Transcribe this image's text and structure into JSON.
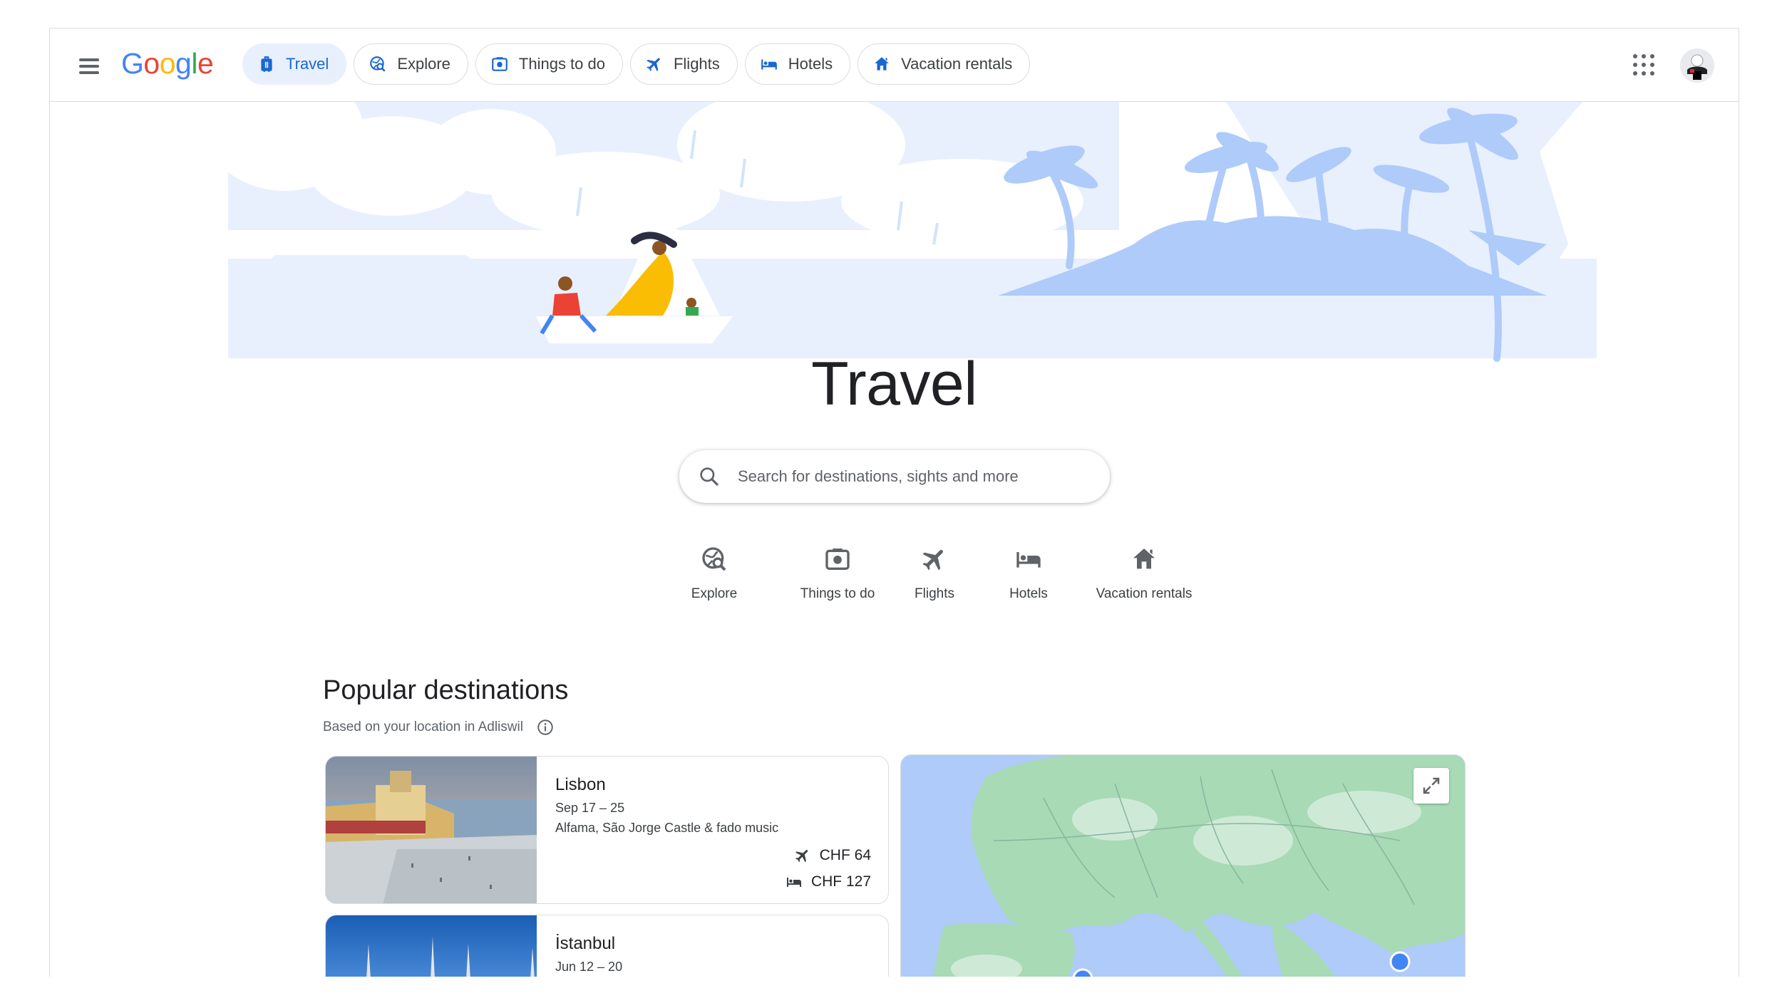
{
  "header": {
    "logo_text": "Google",
    "logo_colors": [
      "#4285F4",
      "#EA4335",
      "#FBBC05",
      "#4285F4",
      "#34A853",
      "#EA4335"
    ],
    "tabs": [
      {
        "label": "Travel",
        "icon": "luggage-icon",
        "active": true
      },
      {
        "label": "Explore",
        "icon": "explore-globe-icon",
        "active": false
      },
      {
        "label": "Things to do",
        "icon": "camera-icon",
        "active": false
      },
      {
        "label": "Flights",
        "icon": "airplane-icon",
        "active": false
      },
      {
        "label": "Hotels",
        "icon": "bed-icon",
        "active": false
      },
      {
        "label": "Vacation rentals",
        "icon": "house-icon",
        "active": false
      }
    ],
    "accent_color": "#1967D2"
  },
  "hero": {
    "title": "Travel",
    "search_placeholder": "Search for destinations, sights and more"
  },
  "quick_links": [
    {
      "label": "Explore",
      "icon": "explore-globe-icon"
    },
    {
      "label": "Things to do",
      "icon": "camera-icon"
    },
    {
      "label": "Flights",
      "icon": "airplane-icon"
    },
    {
      "label": "Hotels",
      "icon": "bed-icon"
    },
    {
      "label": "Vacation rentals",
      "icon": "house-icon"
    }
  ],
  "popular": {
    "title": "Popular destinations",
    "subtitle": "Based on your location in Adliswil",
    "destinations": [
      {
        "name": "Lisbon",
        "dates": "Sep 17 – 25",
        "description": "Alfama, São Jorge Castle & fado music",
        "flight_price": "CHF 64",
        "hotel_price": "CHF 127"
      },
      {
        "name": "İstanbul",
        "dates": "Jun 12 – 20"
      }
    ]
  }
}
